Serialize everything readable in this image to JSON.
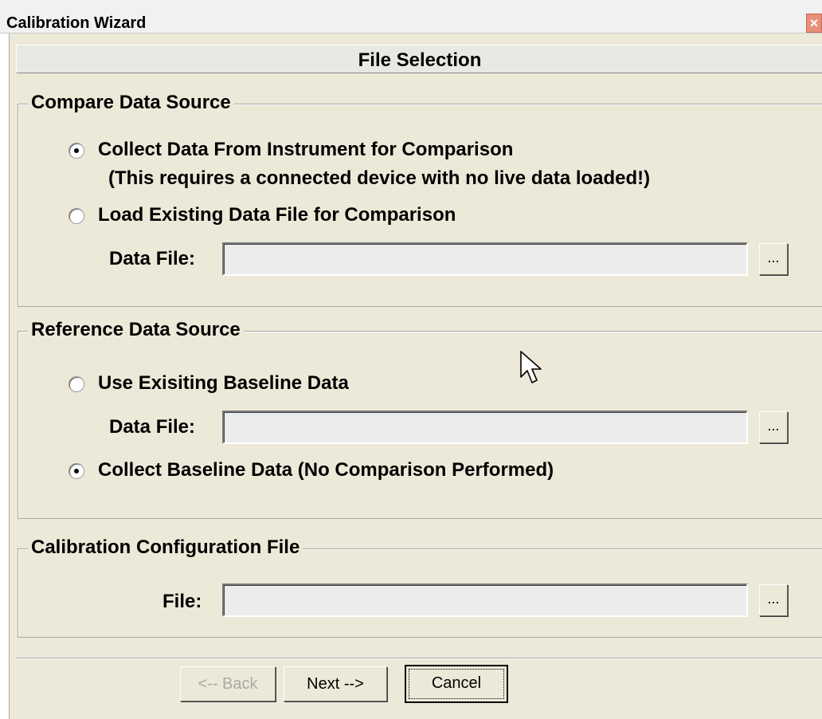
{
  "window": {
    "title": "Calibration Wizard",
    "close_glyph": "×"
  },
  "header": {
    "title": "File Selection"
  },
  "compare_source": {
    "legend": "Compare Data Source",
    "option_collect": {
      "label": "Collect Data From Instrument for Comparison",
      "note": "(This requires a connected device with no live data loaded!)",
      "selected": true
    },
    "option_load": {
      "label": "Load Existing Data File for Comparison",
      "selected": false
    },
    "data_file": {
      "label": "Data File:",
      "value": ""
    },
    "browse_label": "..."
  },
  "reference_source": {
    "legend": "Reference Data Source",
    "option_existing": {
      "label": "Use Exisiting Baseline Data",
      "selected": false
    },
    "data_file": {
      "label": "Data File:",
      "value": ""
    },
    "browse_label": "...",
    "option_collect": {
      "label": "Collect Baseline Data (No Comparison Performed)",
      "selected": true
    }
  },
  "config": {
    "legend": "Calibration Configuration File",
    "file": {
      "label": "File:",
      "value": ""
    },
    "browse_label": "..."
  },
  "buttons": {
    "back": {
      "label": "<-- Back",
      "enabled": false
    },
    "next": {
      "label": "Next -->",
      "enabled": true
    },
    "cancel": {
      "label": "Cancel",
      "enabled": true
    }
  },
  "icons": {
    "cursor": "arrow-cursor-icon",
    "close": "close-icon"
  },
  "colors": {
    "dialog_bg": "#ece9d8",
    "close_button": "#e8907a",
    "disabled_text": "#a8a8a8"
  }
}
